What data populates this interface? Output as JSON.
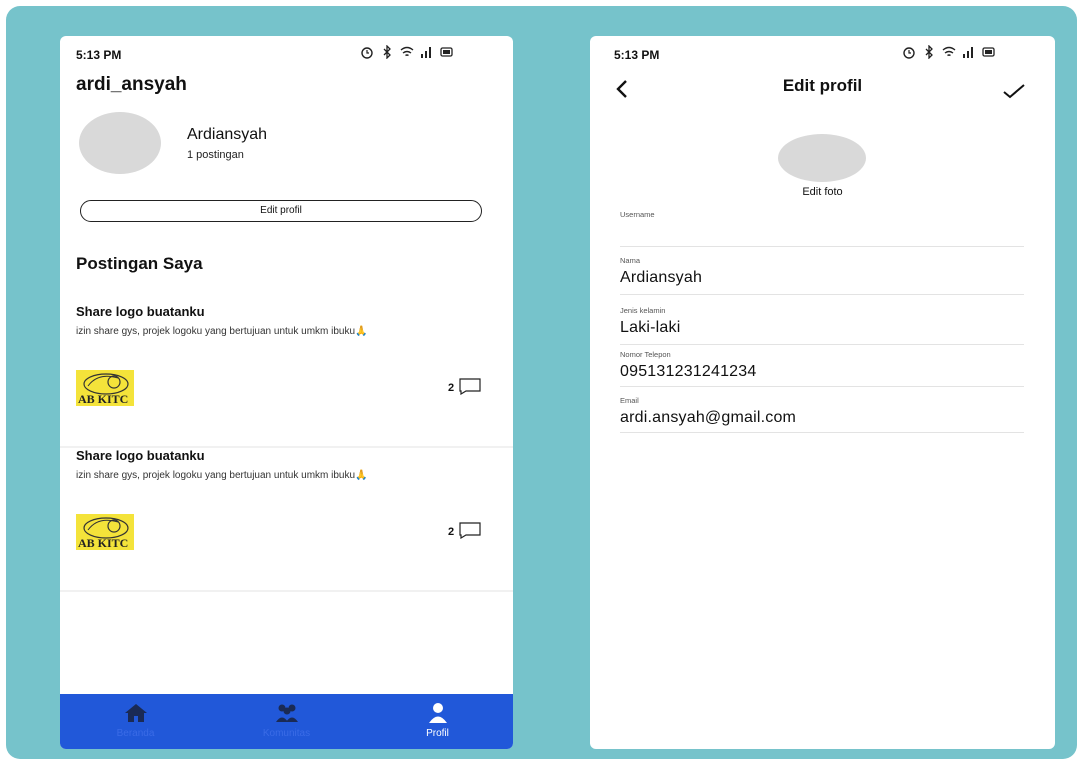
{
  "left_screen": {
    "status_time": "5:13 PM",
    "username": "ardi_ansyah",
    "profile": {
      "display_name": "Ardiansyah",
      "post_count": "1 postingan",
      "edit_button": "Edit profil"
    },
    "section_title": "Postingan Saya",
    "posts": [
      {
        "title": "Share logo buatanku",
        "body": "izin share gys, projek logoku yang bertujuan untuk umkm ibuku",
        "emoji": "🙏",
        "logo_text": "AB KITC",
        "comment_count": "2"
      },
      {
        "title": "Share logo buatanku",
        "body": "izin share gys, projek logoku yang bertujuan untuk umkm ibuku",
        "emoji": "🙏",
        "logo_text": "AB KITC",
        "comment_count": "2"
      }
    ],
    "bottom_nav": [
      {
        "label": "Beranda",
        "icon": "home-icon",
        "active": false
      },
      {
        "label": "Komunitas",
        "icon": "community-icon",
        "active": false
      },
      {
        "label": "Profil",
        "icon": "profile-icon",
        "active": true
      }
    ]
  },
  "right_screen": {
    "status_time": "5:13 PM",
    "title": "Edit profil",
    "edit_photo": "Edit foto",
    "fields": [
      {
        "label": "Username",
        "value": ""
      },
      {
        "label": "Nama",
        "value": "Ardiansyah"
      },
      {
        "label": "Jenis kelamin",
        "value": "Laki-laki"
      },
      {
        "label": "Nomor Telepon",
        "value": "095131231241234"
      },
      {
        "label": "Email",
        "value": "ardi.ansyah@gmail.com"
      }
    ]
  },
  "colors": {
    "background": "#76c3cb",
    "nav": "#2158d9",
    "avatar": "#d9d9d9",
    "logo": "#f4e33a"
  }
}
